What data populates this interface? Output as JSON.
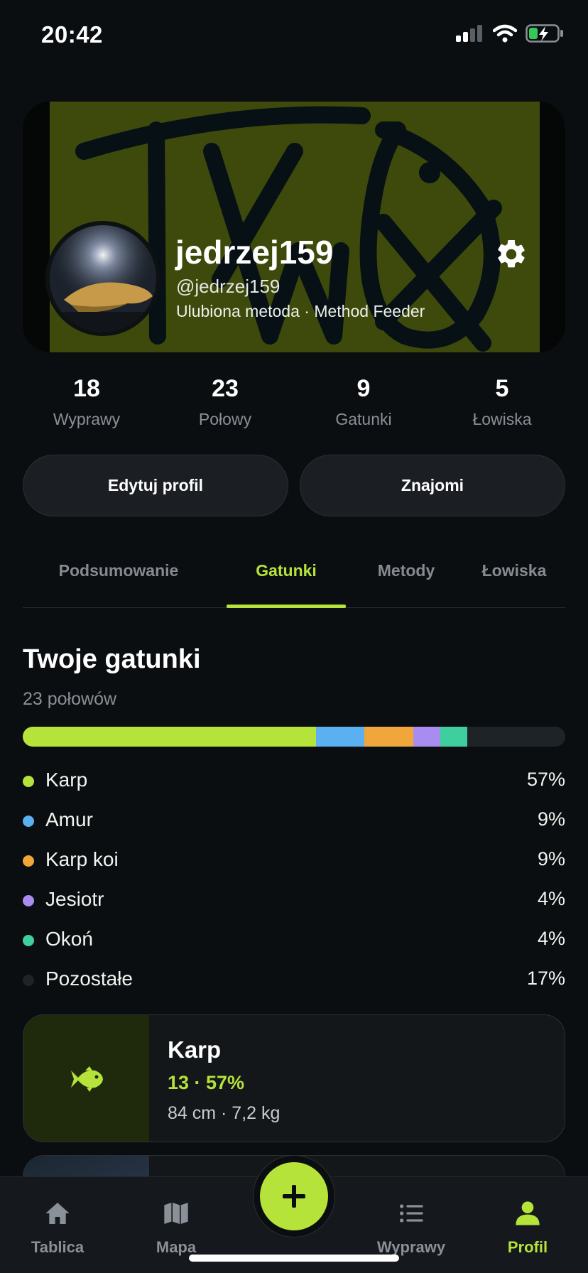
{
  "status_bar": {
    "time": "20:42"
  },
  "profile": {
    "name": "jedrzej159",
    "handle": "@jedrzej159",
    "favorite_method": "Ulubiona metoda · Method Feeder"
  },
  "stats": [
    {
      "value": "18",
      "label": "Wyprawy"
    },
    {
      "value": "23",
      "label": "Połowy"
    },
    {
      "value": "9",
      "label": "Gatunki"
    },
    {
      "value": "5",
      "label": "Łowiska"
    }
  ],
  "actions": {
    "edit_profile": "Edytuj profil",
    "friends": "Znajomi"
  },
  "tabs": [
    {
      "label": "Podsumowanie",
      "active": false
    },
    {
      "label": "Gatunki",
      "active": true
    },
    {
      "label": "Metody",
      "active": false
    },
    {
      "label": "Łowiska",
      "active": false
    }
  ],
  "species_section": {
    "title": "Twoje gatunki",
    "subtitle": "23 połowów",
    "distribution": [
      {
        "name": "Karp",
        "percent": "57%",
        "share": 54,
        "color": "#b5e33a"
      },
      {
        "name": "Amur",
        "percent": "9%",
        "share": 9,
        "color": "#5ab0f0"
      },
      {
        "name": "Karp koi",
        "percent": "9%",
        "share": 9,
        "color": "#f0a63a"
      },
      {
        "name": "Jesiotr",
        "percent": "4%",
        "share": 5,
        "color": "#a98cf0"
      },
      {
        "name": "Okoń",
        "percent": "4%",
        "share": 5,
        "color": "#3fcf9e"
      },
      {
        "name": "Pozostałe",
        "percent": "17%",
        "share": 18,
        "color": "#1e2328"
      }
    ]
  },
  "species_card": {
    "name": "Karp",
    "count_percent": "13 · 57%",
    "size_weight": "84 cm · 7,2 kg",
    "icon": "fish-icon"
  },
  "nav": [
    {
      "label": "Tablica",
      "icon": "home-icon",
      "active": false
    },
    {
      "label": "Mapa",
      "icon": "map-icon",
      "active": false
    },
    {
      "label": "Wyprawy",
      "icon": "list-icon",
      "active": false
    },
    {
      "label": "Profil",
      "icon": "person-icon",
      "active": true
    }
  ],
  "colors": {
    "accent": "#b5e33a",
    "background": "#0a0e10",
    "card": "#141719"
  }
}
